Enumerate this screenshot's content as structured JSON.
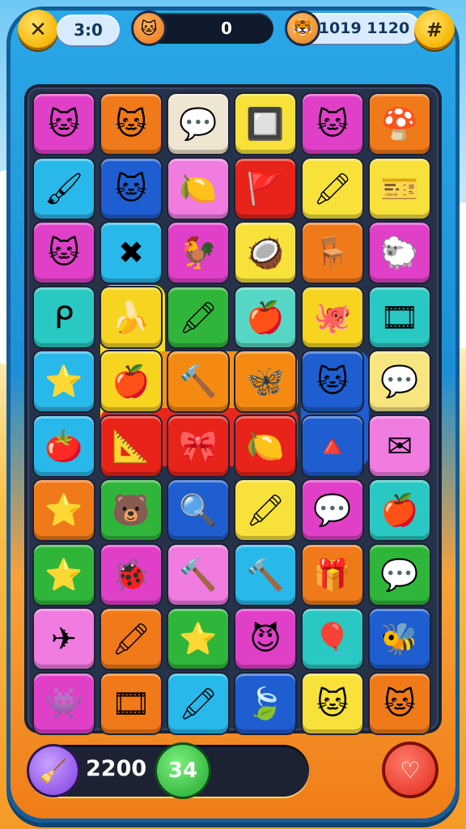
{
  "hud": {
    "left_counter": "3:0",
    "score": "0",
    "right_counter": "1019 1120"
  },
  "bottom": {
    "points": "2200",
    "moves": "34"
  },
  "colors": {
    "accent": "#f5b400",
    "board": "#26324a"
  },
  "tiles": [
    {
      "icon": "🐱",
      "color": "#e040c8"
    },
    {
      "icon": "🐱",
      "color": "#f07a1a"
    },
    {
      "icon": "💬",
      "color": "#efe6d2"
    },
    {
      "icon": "🔲",
      "color": "#f7e13a"
    },
    {
      "icon": "🐱",
      "color": "#e040c8"
    },
    {
      "icon": "🍄",
      "color": "#f07a1a"
    },
    {
      "icon": "🖌",
      "color": "#29b8ea"
    },
    {
      "icon": "🐱",
      "color": "#1e5ed0"
    },
    {
      "icon": "🍋",
      "color": "#f07ce0"
    },
    {
      "icon": "🚩",
      "color": "#e8231a"
    },
    {
      "icon": "🖍",
      "color": "#f7e13a"
    },
    {
      "icon": "🎫",
      "color": "#f7e13a"
    },
    {
      "icon": "🐱",
      "color": "#e040c8"
    },
    {
      "icon": "✖",
      "color": "#29b8ea"
    },
    {
      "icon": "🐓",
      "color": "#e040c8"
    },
    {
      "icon": "🥥",
      "color": "#f7e13a"
    },
    {
      "icon": "🪑",
      "color": "#f07a1a"
    },
    {
      "icon": "🐑",
      "color": "#e040c8"
    },
    {
      "icon": "ᑭ",
      "color": "#29c8c2"
    },
    {
      "icon": "🍌",
      "color": "#f7d420"
    },
    {
      "icon": "🖍",
      "color": "#2fb63a"
    },
    {
      "icon": "🍎",
      "color": "#56d6c4"
    },
    {
      "icon": "🐙",
      "color": "#f7d420"
    },
    {
      "icon": "🎞",
      "color": "#29c8c2"
    },
    {
      "icon": "⭐",
      "color": "#29b8ea"
    },
    {
      "icon": "🍎",
      "color": "#f7d420"
    },
    {
      "icon": "🔨",
      "color": "#f58a12"
    },
    {
      "icon": "🦋",
      "color": "#f58a12"
    },
    {
      "icon": "🐱",
      "color": "#1e5ed0"
    },
    {
      "icon": "💬",
      "color": "#f7e680"
    },
    {
      "icon": "🍅",
      "color": "#29b8ea"
    },
    {
      "icon": "📐",
      "color": "#e8231a"
    },
    {
      "icon": "🎀",
      "color": "#e8231a"
    },
    {
      "icon": "🍋",
      "color": "#e8231a"
    },
    {
      "icon": "🔺",
      "color": "#1e5ed0"
    },
    {
      "icon": "✉",
      "color": "#f07ce0"
    },
    {
      "icon": "⭐",
      "color": "#f07a1a"
    },
    {
      "icon": "🐻",
      "color": "#2fb63a"
    },
    {
      "icon": "🔍",
      "color": "#1e5ed0"
    },
    {
      "icon": "🖍",
      "color": "#f7e13a"
    },
    {
      "icon": "💬",
      "color": "#e040c8"
    },
    {
      "icon": "🍎",
      "color": "#29c8c2"
    },
    {
      "icon": "⭐",
      "color": "#2fb63a"
    },
    {
      "icon": "🐞",
      "color": "#e040c8"
    },
    {
      "icon": "🔨",
      "color": "#f07ce0"
    },
    {
      "icon": "🔨",
      "color": "#29b8ea"
    },
    {
      "icon": "🎁",
      "color": "#f07a1a"
    },
    {
      "icon": "💬",
      "color": "#2fb63a"
    },
    {
      "icon": "✈",
      "color": "#f07ce0"
    },
    {
      "icon": "🖍",
      "color": "#f07a1a"
    },
    {
      "icon": "⭐",
      "color": "#2fb63a"
    },
    {
      "icon": "😈",
      "color": "#e040c8"
    },
    {
      "icon": "🎈",
      "color": "#29c8c2"
    },
    {
      "icon": "🐝",
      "color": "#1e5ed0"
    },
    {
      "icon": "👾",
      "color": "#e040c8"
    },
    {
      "icon": "🎞",
      "color": "#f07a1a"
    },
    {
      "icon": "🖍",
      "color": "#29b8ea"
    },
    {
      "icon": "🍃",
      "color": "#1e5ed0"
    },
    {
      "icon": "🐱",
      "color": "#f7e13a"
    },
    {
      "icon": "🐱",
      "color": "#f07a1a"
    }
  ]
}
